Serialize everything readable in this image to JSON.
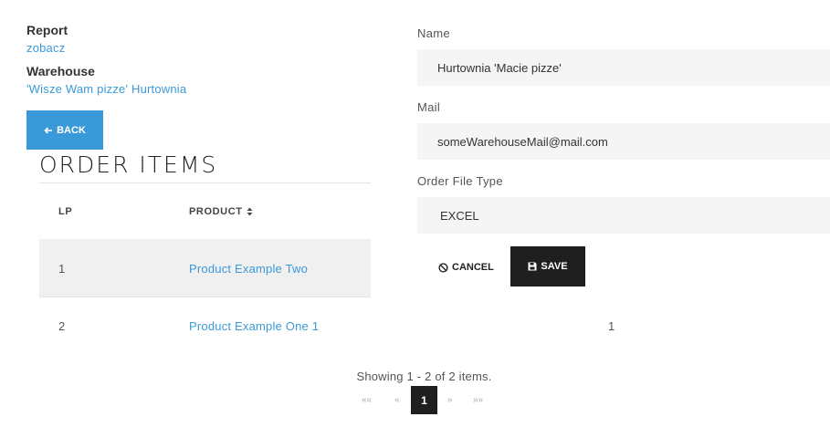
{
  "report": {
    "label": "Report",
    "link": "zobacz"
  },
  "warehouse": {
    "label": "Warehouse",
    "link": "'Wisze Wam pizze' Hurtownia"
  },
  "back_button": {
    "label": "BACK"
  },
  "order_items": {
    "title": "ORDER ITEMS",
    "columns": [
      "LP",
      "PRODUCT"
    ],
    "rows": [
      {
        "lp": "1",
        "product": "Product Example Two"
      },
      {
        "lp": "2",
        "product": "Product Example One 1",
        "extra": "1"
      }
    ]
  },
  "form": {
    "name_label": "Name",
    "name_value": "Hurtownia 'Macie pizze'",
    "mail_label": "Mail",
    "mail_value": "someWarehouseMail@mail.com",
    "file_type_label": "Order File Type",
    "file_type_value": "EXCEL",
    "cancel_label": "CANCEL",
    "save_label": "SAVE"
  },
  "pagination": {
    "summary": "Showing 1 - 2 of 2 items.",
    "first": "««",
    "prev": "«",
    "current": "1",
    "next": "»",
    "last": "»»"
  },
  "colors": {
    "accent": "#3a9ad9",
    "dark": "#1f1f1f",
    "field_bg": "#f5f5f6",
    "row_hover": "#f0f0f0"
  }
}
